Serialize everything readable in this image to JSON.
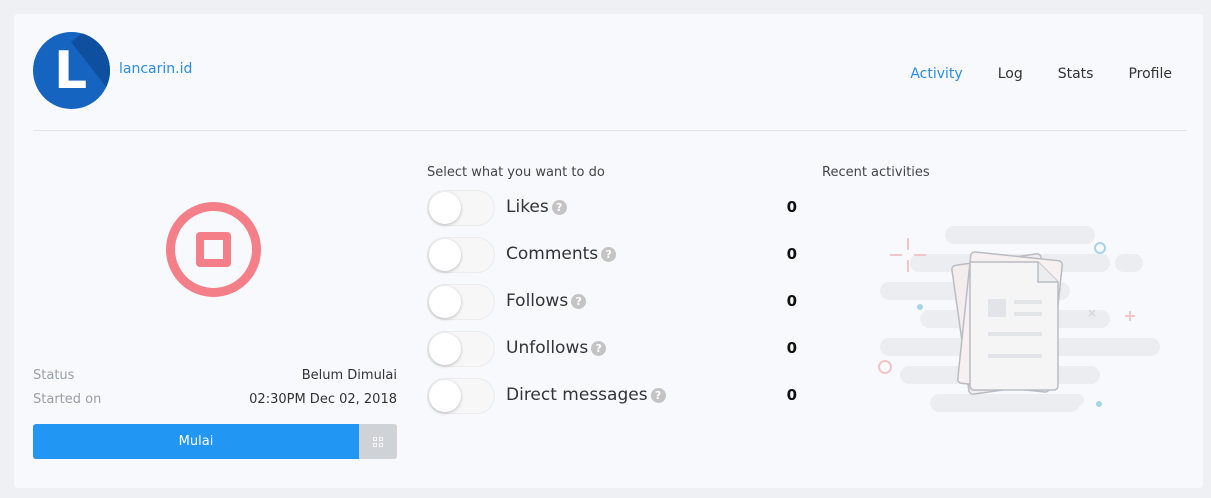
{
  "header": {
    "logo_letter": "L",
    "brand_name": "lancarin.id",
    "nav": [
      {
        "label": "Activity",
        "active": true
      },
      {
        "label": "Log",
        "active": false
      },
      {
        "label": "Stats",
        "active": false
      },
      {
        "label": "Profile",
        "active": false
      }
    ]
  },
  "status_panel": {
    "status_label": "Status",
    "status_value": "Belum Dimulai",
    "started_label": "Started on",
    "started_value": "02:30PM Dec 02, 2018",
    "start_button_label": "Mulai",
    "stop_icon": "stop-circle-icon",
    "stop_icon_color": "#f47f88",
    "start_button_color": "#2196f3"
  },
  "actions": {
    "title": "Select what you want to do",
    "items": [
      {
        "label": "Likes",
        "count": "0",
        "enabled": false
      },
      {
        "label": "Comments",
        "count": "0",
        "enabled": false
      },
      {
        "label": "Follows",
        "count": "0",
        "enabled": false
      },
      {
        "label": "Unfollows",
        "count": "0",
        "enabled": false
      },
      {
        "label": "Direct messages",
        "count": "0",
        "enabled": false
      }
    ],
    "help_glyph": "?"
  },
  "recent": {
    "title": "Recent activities",
    "illustration": "empty-documents-icon"
  },
  "colors": {
    "accent": "#2b8be6",
    "logo_blue": "#1565c0"
  }
}
